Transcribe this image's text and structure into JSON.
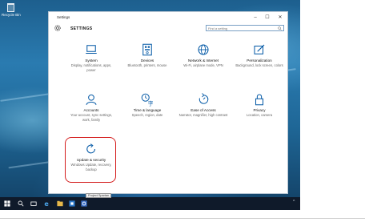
{
  "desktop": {
    "recycle_bin_label": "Recycle Bin"
  },
  "window": {
    "title": "Settings",
    "minimize_glyph": "–",
    "maximize_glyph": "☐",
    "close_glyph": "✕",
    "header": "SETTINGS",
    "search_placeholder": "Find a setting"
  },
  "tiles": [
    {
      "title": "System",
      "desc": "Display, notifications, apps, power",
      "icon": "laptop-icon"
    },
    {
      "title": "Devices",
      "desc": "Bluetooth, printers, mouse",
      "icon": "keyboard-icon"
    },
    {
      "title": "Network & Internet",
      "desc": "Wi-Fi, airplane mode, VPN",
      "icon": "globe-icon"
    },
    {
      "title": "Personalization",
      "desc": "Background, lock screen, colors",
      "icon": "pen-icon"
    },
    {
      "title": "Accounts",
      "desc": "Your account, sync settings, work, family",
      "icon": "person-icon"
    },
    {
      "title": "Time & language",
      "desc": "Speech, region, date",
      "icon": "time-language-icon"
    },
    {
      "title": "Ease of Access",
      "desc": "Narrator, magnifier, high contrast",
      "icon": "ease-of-access-icon"
    },
    {
      "title": "Privacy",
      "desc": "Location, camera",
      "icon": "lock-icon"
    },
    {
      "title": "Update & security",
      "desc": "Windows Update, recovery, backup",
      "icon": "refresh-icon"
    }
  ],
  "taskbar": {
    "tooltip": "Project Spartan"
  },
  "colors": {
    "accent": "#0a5da8",
    "highlight": "#d41c1c",
    "taskbar": "#0f1a2a"
  }
}
